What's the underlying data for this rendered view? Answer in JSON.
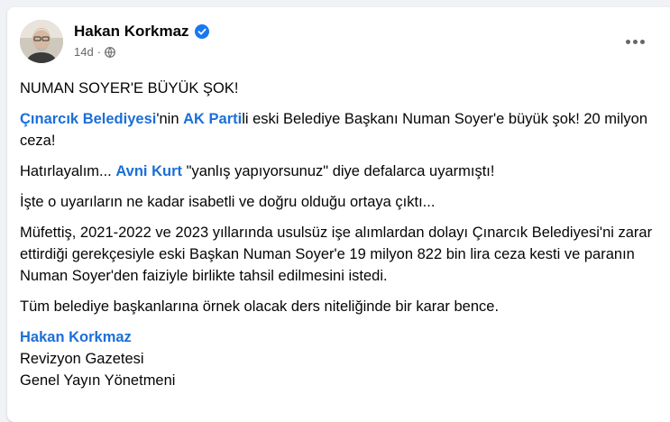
{
  "post": {
    "author": "Hakan Korkmaz",
    "time": "14d",
    "meta_separator": "·",
    "verified_icon": "verified-badge-icon",
    "privacy_icon": "globe-icon",
    "more_icon": "more-options-icon",
    "accent_color": "#1b6fd8"
  },
  "content": {
    "headline": "NUMAN SOYER'E BÜYÜK ŞOK!",
    "p1": {
      "link1": "Çınarcık Belediyesi",
      "t1": "'nin ",
      "link2": "AK Parti",
      "t2": "li eski Belediye Başkanı Numan Soyer'e büyük şok! 20 milyon ceza!"
    },
    "p2": {
      "t1": "Hatırlayalım... ",
      "link": "Avni Kurt",
      "t2": " \"yanlış yapıyorsunuz\" diye defalarca uyarmıştı!"
    },
    "p3": "İşte o uyarıların ne kadar isabetli ve doğru olduğu ortaya çıktı...",
    "p4": "Müfettiş, 2021-2022 ve 2023 yıllarında usulsüz işe alımlardan dolayı Çınarcık Belediyesi'ni zarar ettirdiği gerekçesiyle eski Başkan Numan Soyer'e 19 milyon 822 bin lira ceza kesti ve paranın Numan Soyer'den faiziyle birlikte tahsil edilmesini istedi.",
    "p5": "Tüm belediye başkanlarına örnek olacak ders niteliğinde bir karar bence.",
    "signature": {
      "name": "Hakan Korkmaz",
      "line1": "Revizyon Gazetesi",
      "line2": "Genel Yayın Yönetmeni"
    }
  }
}
